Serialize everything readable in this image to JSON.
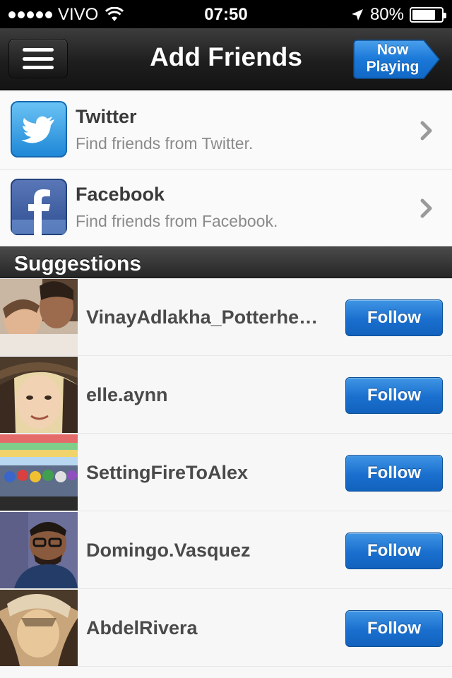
{
  "status_bar": {
    "carrier": "VIVO",
    "time": "07:50",
    "battery": "80%",
    "battery_level": 0.8
  },
  "nav": {
    "title": "Add Friends",
    "now_playing_line1": "Now",
    "now_playing_line2": "Playing"
  },
  "social": [
    {
      "name": "Twitter",
      "subtitle": "Find friends from Twitter.",
      "icon": "twitter-icon",
      "color": "#3a9de3"
    },
    {
      "name": "Facebook",
      "subtitle": "Find friends from Facebook.",
      "icon": "facebook-icon",
      "color": "#3b5998"
    }
  ],
  "section": {
    "title": "Suggestions"
  },
  "suggestions": [
    {
      "username": "VinayAdlakha_Potterhe…",
      "button": "Follow"
    },
    {
      "username": "elle.aynn",
      "button": "Follow"
    },
    {
      "username": "SettingFireToAlex",
      "button": "Follow"
    },
    {
      "username": "Domingo.Vasquez",
      "button": "Follow"
    },
    {
      "username": "AbdelRivera",
      "button": "Follow"
    }
  ],
  "colors": {
    "follow_button": "#1a6fce",
    "nav_bar": "#1e1e1e",
    "now_playing": "#1a78d8"
  }
}
